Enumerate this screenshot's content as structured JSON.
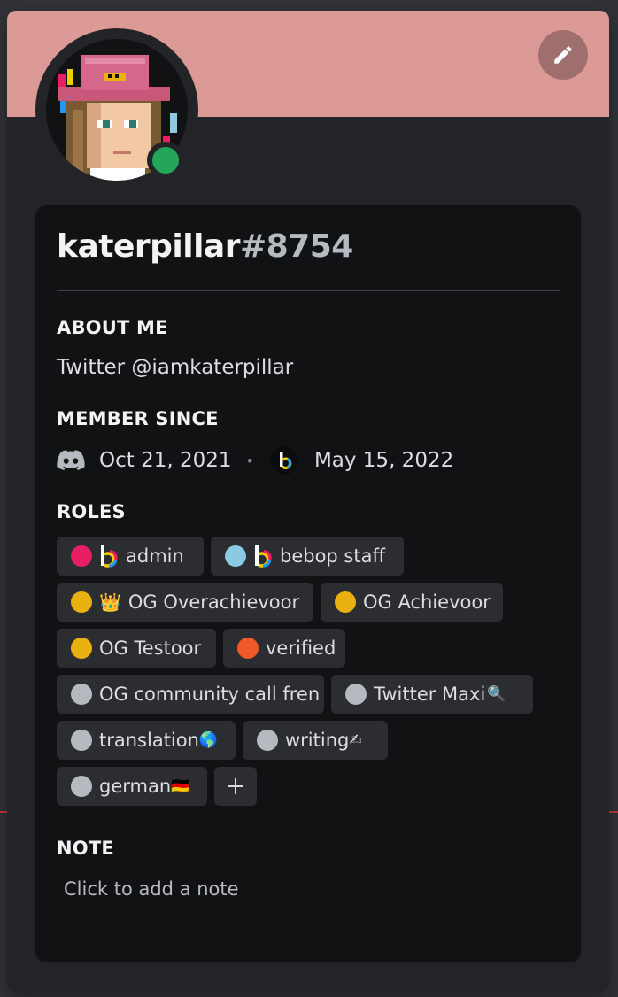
{
  "colors": {
    "banner": "#dc9a97",
    "status_online": "#23a55a",
    "role_admin": "#e91e63",
    "role_bebop_staff": "#8cc9e3",
    "role_gold": "#e9b10f",
    "role_verified": "#f05a28",
    "role_default": "#b5bac1"
  },
  "profile": {
    "username": "katerpillar",
    "discriminator": "#8754",
    "edit_icon": "pencil-icon",
    "status": "online"
  },
  "about": {
    "heading": "ABOUT ME",
    "text": "Twitter @iamkaterpillar"
  },
  "member_since": {
    "heading": "MEMBER SINCE",
    "discord_icon": "discord-icon",
    "discord_date": "Oct 21, 2021",
    "separator": "•",
    "server_icon": "bebop-server-icon",
    "server_date": "May 15, 2022"
  },
  "roles": {
    "heading": "ROLES",
    "items": [
      {
        "label": "admin",
        "color": "#e91e63",
        "icon": "bebop-icon"
      },
      {
        "label": "bebop staff",
        "color": "#8cc9e3",
        "icon": "bebop-icon"
      },
      {
        "label": "OG Overachievoor",
        "color": "#e9b10f",
        "icon": "crown-icon",
        "icon_glyph": "👑"
      },
      {
        "label": "OG Achievoor",
        "color": "#e9b10f"
      },
      {
        "label": "OG Testoor",
        "color": "#e9b10f"
      },
      {
        "label": "verified",
        "color": "#f05a28"
      },
      {
        "label": "OG community call fren",
        "color": "#b5bac1"
      },
      {
        "label": "Twitter Maxi",
        "color": "#b5bac1",
        "suffix": "🔍"
      },
      {
        "label": "translation",
        "color": "#b5bac1",
        "suffix": "🌎"
      },
      {
        "label": "writing",
        "color": "#b5bac1",
        "suffix": "✍"
      },
      {
        "label": "german",
        "color": "#b5bac1",
        "suffix": "🇩🇪"
      }
    ],
    "add_icon": "plus-icon"
  },
  "note": {
    "heading": "NOTE",
    "placeholder": "Click to add a note"
  }
}
